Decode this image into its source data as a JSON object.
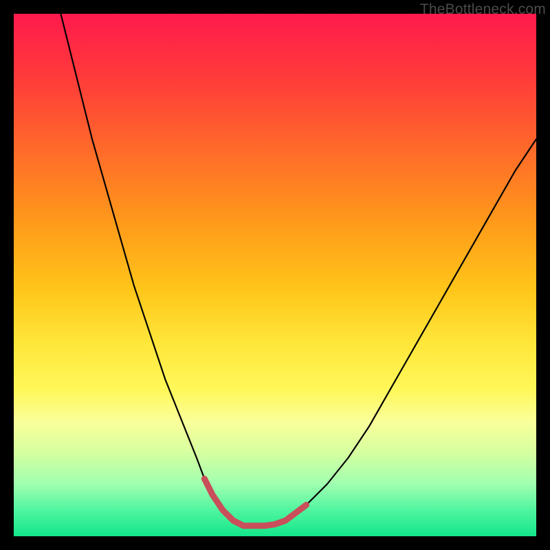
{
  "watermark": "TheBottleneck.com",
  "chart_data": {
    "type": "line",
    "title": "",
    "xlabel": "",
    "ylabel": "",
    "xlim": [
      0,
      100
    ],
    "ylim": [
      0,
      100
    ],
    "series": [
      {
        "name": "black-curve",
        "x": [
          9,
          11,
          13,
          15,
          17,
          19,
          21,
          23,
          25,
          27,
          29,
          31,
          33,
          35,
          36.5,
          38,
          40,
          42,
          44,
          48,
          52,
          56,
          60,
          64,
          68,
          72,
          76,
          80,
          84,
          88,
          92,
          96,
          100
        ],
        "y": [
          100,
          92,
          84,
          76,
          69,
          62,
          55,
          48,
          42,
          36,
          30,
          25,
          20,
          15,
          11,
          8,
          5,
          3,
          2,
          2,
          3,
          6,
          10,
          15,
          21,
          28,
          35,
          42,
          49,
          56,
          63,
          70,
          76
        ],
        "stroke": "#000000",
        "stroke_width": 2.2
      },
      {
        "name": "red-bottom-highlight",
        "x": [
          36.5,
          38,
          40,
          42,
          44,
          46,
          48,
          50,
          52,
          54,
          56
        ],
        "y": [
          11,
          8,
          5,
          3,
          2,
          2,
          2,
          2.3,
          3,
          4.5,
          6
        ],
        "stroke": "#c94f5a",
        "stroke_width": 9
      }
    ]
  }
}
